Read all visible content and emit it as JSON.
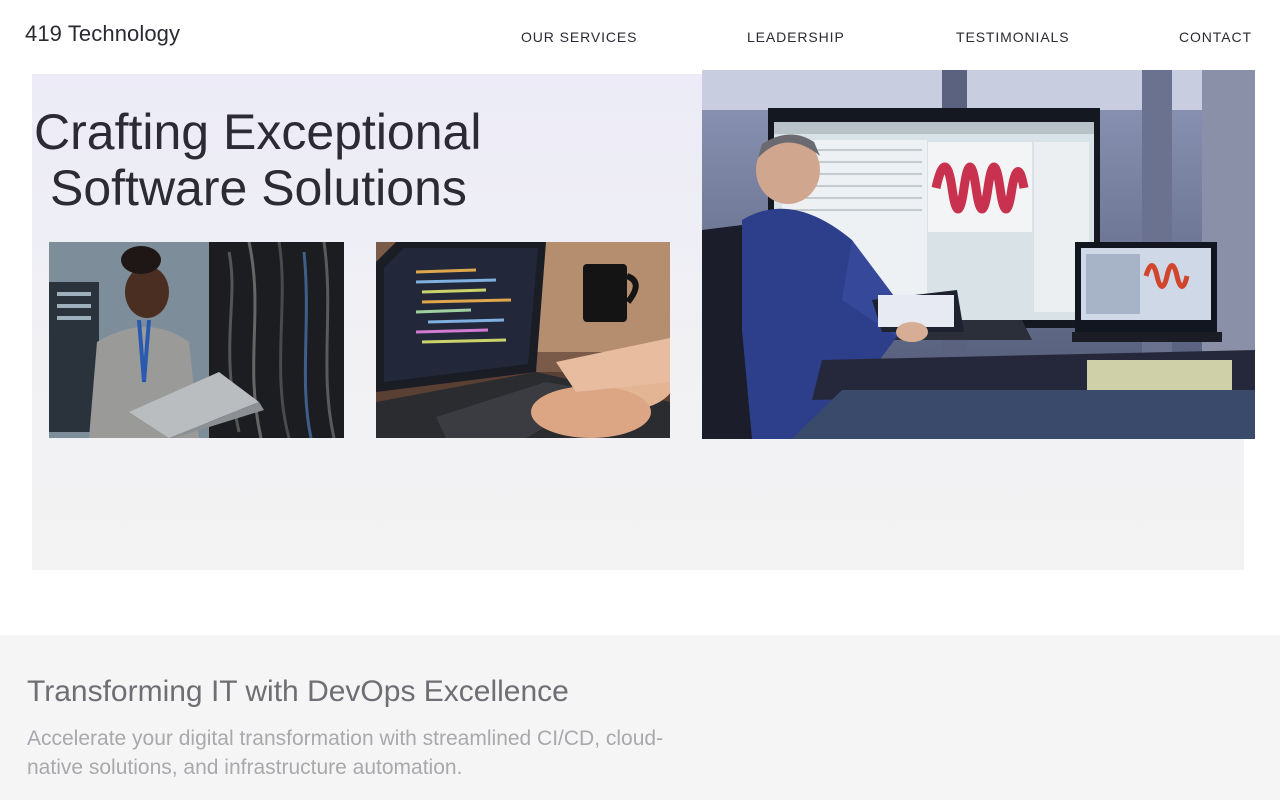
{
  "header": {
    "brand": "419 Technology",
    "nav": [
      {
        "label": "OUR SERVICES"
      },
      {
        "label": "LEADERSHIP"
      },
      {
        "label": "TESTIMONIALS"
      },
      {
        "label": "CONTACT"
      }
    ]
  },
  "hero": {
    "title_line1": "Crafting Exceptional",
    "title_line2": "Software Solutions"
  },
  "section2": {
    "title": "Transforming IT with DevOps Excellence",
    "text": "Accelerate your digital transformation with streamlined CI/CD, cloud-native solutions, and infrastructure automation."
  },
  "colors": {
    "text_dark": "#2a2a33",
    "hero_bg": "#ecebf7",
    "section_bg": "#f5f5f5",
    "muted_title": "#6e6e74",
    "muted_text": "#a9a9ad"
  }
}
